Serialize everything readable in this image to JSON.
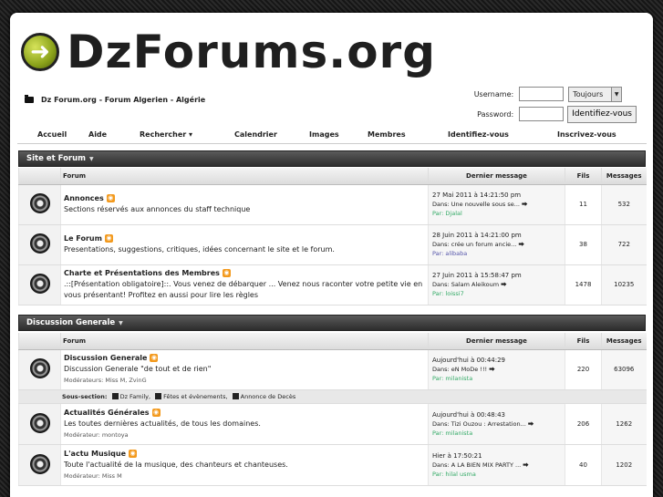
{
  "logo": {
    "text": "DzForums.org"
  },
  "header": {
    "site_title": "Dz Forum.org - Forum Algerien - Algérie"
  },
  "login": {
    "username_label": "Username:",
    "password_label": "Password:",
    "remember_value": "Toujours",
    "submit_label": "Identifiez-vous"
  },
  "nav": {
    "items": [
      "Accueil",
      "Aide",
      "Rechercher ▾",
      "Calendrier",
      "Images",
      "Membres",
      "Identifiez-vous",
      "Inscrivez-vous"
    ]
  },
  "headers": {
    "forum": "Forum",
    "last": "Dernier message",
    "threads": "Fils",
    "messages": "Messages"
  },
  "sections": [
    {
      "title": "Site et Forum",
      "forums": [
        {
          "name": "Annonces",
          "desc": "Sections réservés aux annonces du staff technique",
          "last_date": "27 Mai 2011 à 14:21:50 pm",
          "last_in": "Dans: Une nouvelle sous se...",
          "last_by": "Par: Djalal",
          "threads": "11",
          "messages": "532"
        },
        {
          "name": "Le Forum",
          "desc": "Presentations, suggestions, critiques, idées concernant le site et le forum.",
          "last_date": "28 Juin 2011 à 14:21:00 pm",
          "last_in": "Dans: crée un forum ancie...",
          "last_by": "Par: alibaba",
          "threads": "38",
          "messages": "722"
        },
        {
          "name": "Charte et Présentations des Membres",
          "desc": ".::[Présentation obligatoire]::. Vous venez de débarquer ... Venez nous raconter votre petite vie en vous présentant! Profitez en aussi pour lire les règles",
          "last_date": "27 Juin 2011 à 15:58:47 pm",
          "last_in": "Dans: Salam Aleikoum",
          "last_by": "Par: loissi7",
          "threads": "1478",
          "messages": "10235"
        }
      ]
    },
    {
      "title": "Discussion Generale",
      "forums": [
        {
          "name": "Discussion Generale",
          "desc": "Discussion Generale \"de tout et de rien\"",
          "mod": "Modérateurs: Miss M, ZvinG",
          "last_date": "Aujourd'hui à 00:44:29",
          "last_in": "Dans: eN MoDe !!!",
          "last_by": "Par: milanista",
          "threads": "220",
          "messages": "63096"
        },
        {
          "name": "Actualités Générales",
          "desc": "Les toutes dernières actualités, de tous les domaines.",
          "mod": "Modérateur: montoya",
          "last_date": "Aujourd'hui à 00:48:43",
          "last_in": "Dans: Tizi Ouzou : Arrestation...",
          "last_by": "Par: milanista",
          "threads": "206",
          "messages": "1262"
        },
        {
          "name": "L'actu Musique",
          "desc": "Toute l'actualité de la musique, des chanteurs et chanteuses.",
          "mod": "Modérateur: Miss M",
          "last_date": "Hier à 17:50:21",
          "last_in": "Dans: A LA BIEN MIX PARTY ...",
          "last_by": "Par: hilal usma",
          "threads": "40",
          "messages": "1202"
        }
      ],
      "subsection": {
        "label": "Sous-section:",
        "items": [
          "Dz Family",
          "Fêtes et évènements",
          "Annonce de Decès"
        ]
      }
    }
  ]
}
